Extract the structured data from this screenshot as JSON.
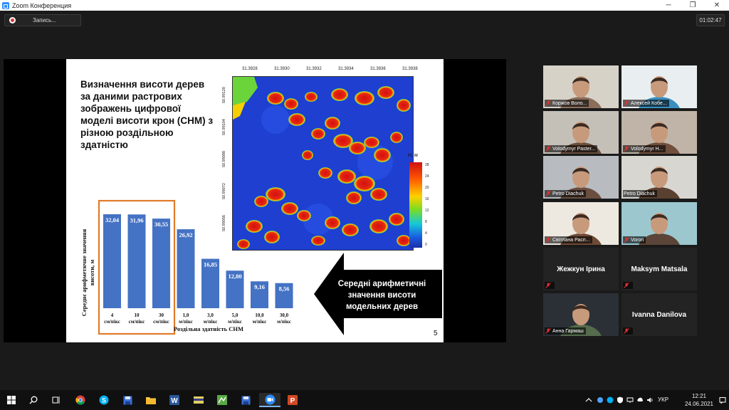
{
  "window": {
    "title": "Zoom Конференция",
    "minimize": "─",
    "restore": "❐",
    "close": "✕"
  },
  "recording": {
    "label": "Запись..."
  },
  "meeting_timer": "01:02:47",
  "slide": {
    "title": "Визначення висоти дерев за даними растрових зображень цифрової моделі висоти крон (CHM) з різною роздільною здатністю",
    "arrow_text": "Середні арифметичні значення висоти модельних дерев",
    "page_number": "5",
    "map": {
      "top_ticks": [
        "31.3928",
        "31.3930",
        "31.3932",
        "31.3934",
        "31.3936",
        "31.3938"
      ],
      "left_ticks": [
        "50.99120",
        "50.99104",
        "50.99088",
        "50.99072",
        "50.99056"
      ],
      "colorbar_label": "H, м",
      "colorbar_ticks": [
        "28",
        "24",
        "20",
        "16",
        "12",
        "8",
        "4",
        "0"
      ]
    }
  },
  "chart_data": {
    "type": "bar",
    "categories": [
      "4 см/пікс",
      "10 см/пікс",
      "30 см/пікс",
      "1,0 м/пікс",
      "3,0 м/пікс",
      "5,0 м/пікс",
      "10,0 м/пікс",
      "30,0 м/пікс"
    ],
    "category_lines": [
      [
        "4",
        "см/пікс"
      ],
      [
        "10",
        "см/пікс"
      ],
      [
        "30",
        "см/пікс"
      ],
      [
        "1,0",
        "м/пікс"
      ],
      [
        "3,0",
        "м/пікс"
      ],
      [
        "5,0",
        "м/пікс"
      ],
      [
        "10,0",
        "м/пікс"
      ],
      [
        "30,0",
        "м/пікс"
      ]
    ],
    "values": [
      32.04,
      31.96,
      30.55,
      26.92,
      16.85,
      12.8,
      9.16,
      8.56
    ],
    "value_labels": [
      "32,04",
      "31,96",
      "30,55",
      "26,92",
      "16,85",
      "12,80",
      "9,16",
      "8,56"
    ],
    "xlabel": "Роздільна здатність CHM",
    "ylabel_lines": [
      "Середнє арифметичне значення",
      "висоти, м"
    ],
    "ylim": [
      0,
      33
    ],
    "bar_color": "#4472c4",
    "highlight_color": "#e07b2a",
    "highlight_range": [
      0,
      2
    ]
  },
  "participants": [
    {
      "name": "Коржов Воло...",
      "type": "video",
      "muted": true
    },
    {
      "name": "Алексей Кобе...",
      "type": "video",
      "muted": true
    },
    {
      "name": "Volodymyr Paster...",
      "type": "video",
      "muted": true
    },
    {
      "name": "Volodymyr H...",
      "type": "video",
      "muted": true
    },
    {
      "name": "Petro Diachuk",
      "type": "video",
      "muted": true
    },
    {
      "name": "Petro Diachuk",
      "type": "video",
      "muted": false,
      "active": true
    },
    {
      "name": "Світлана Расп...",
      "type": "video",
      "muted": true
    },
    {
      "name": "Voron",
      "type": "video",
      "muted": true
    },
    {
      "name": "Жежкун Ірина",
      "type": "name",
      "muted": true
    },
    {
      "name": "Maksym Matsala",
      "type": "name",
      "muted": true
    },
    {
      "name": "Анна Гармаш",
      "type": "video",
      "muted": true
    },
    {
      "name": "Ivanna Danilova",
      "type": "name",
      "muted": true
    }
  ],
  "taskbar": {
    "language": "УКР",
    "time": "12:21",
    "date": "24.06.2021"
  },
  "colors": {
    "accent": "#2d8cff",
    "active_speaker": "#d6ea35",
    "muted": "#e0332e"
  }
}
